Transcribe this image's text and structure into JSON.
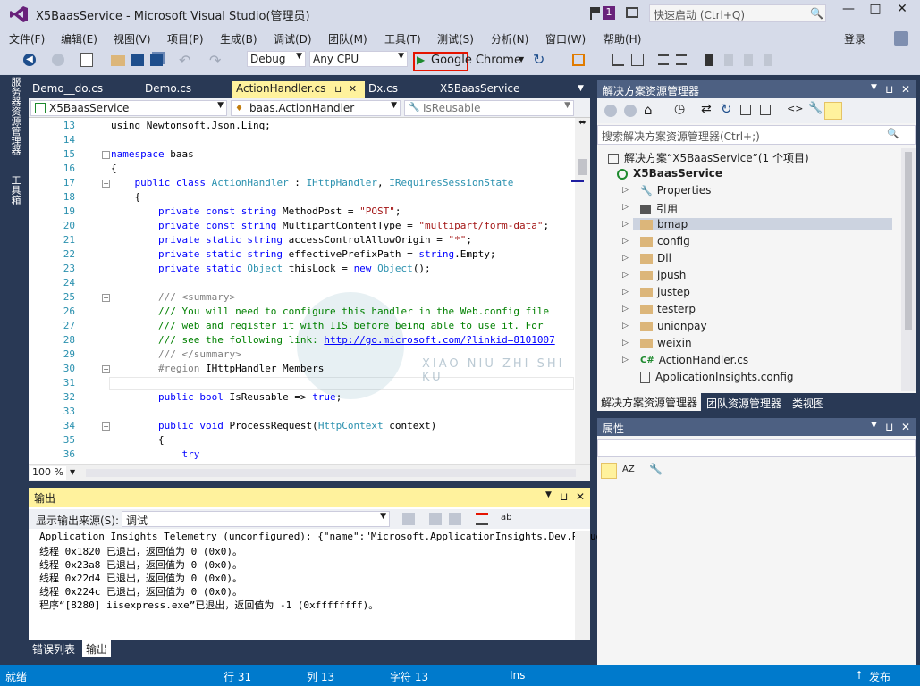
{
  "window": {
    "title": "X5BaasService - Microsoft Visual Studio(管理员)",
    "notif_count": "1",
    "quicklaunch_placeholder": "快速启动 (Ctrl+Q)",
    "login": "登录"
  },
  "menu": [
    "文件(F)",
    "编辑(E)",
    "视图(V)",
    "项目(P)",
    "生成(B)",
    "调试(D)",
    "团队(M)",
    "工具(T)",
    "测试(S)",
    "分析(N)",
    "窗口(W)",
    "帮助(H)"
  ],
  "toolbar": {
    "config": "Debug",
    "platform": "Any CPU",
    "run_target": "Google Chrome"
  },
  "sidebar": {
    "server_explorer": "服务器资源管理器",
    "toolbox": "工具箱"
  },
  "tabs": [
    "Demo__do.cs",
    "Demo.cs",
    "ActionHandler.cs",
    "Dx.cs",
    "X5BaasService"
  ],
  "nav": {
    "project": "X5BaasService",
    "class": "baas.ActionHandler",
    "member": "IsReusable"
  },
  "code": [
    {
      "n": "13",
      "t": [
        [
          "using Newtonsoft.Json.Linq;",
          ""
        ]
      ]
    },
    {
      "n": "14",
      "t": []
    },
    {
      "n": "15",
      "t": [
        [
          "namespace",
          "kw"
        ],
        [
          " baas",
          ""
        ]
      ]
    },
    {
      "n": "16",
      "t": [
        [
          "{",
          ""
        ]
      ]
    },
    {
      "n": "17",
      "t": [
        [
          "    public class ",
          "kw"
        ],
        [
          "ActionHandler",
          "ty"
        ],
        [
          " : ",
          ""
        ],
        [
          "IHttpHandler",
          "ty"
        ],
        [
          ", ",
          ""
        ],
        [
          "IRequiresSessionState",
          "ty"
        ]
      ]
    },
    {
      "n": "18",
      "t": [
        [
          "    {",
          ""
        ]
      ]
    },
    {
      "n": "19",
      "t": [
        [
          "        private const string",
          "kw"
        ],
        [
          " MethodPost = ",
          ""
        ],
        [
          "\"POST\"",
          "st"
        ],
        [
          ";",
          ""
        ]
      ]
    },
    {
      "n": "20",
      "t": [
        [
          "        private const string",
          "kw"
        ],
        [
          " MultipartContentType = ",
          ""
        ],
        [
          "\"multipart/form-data\"",
          "st"
        ],
        [
          ";",
          ""
        ]
      ]
    },
    {
      "n": "21",
      "t": [
        [
          "        private static string",
          "kw"
        ],
        [
          " accessControlAllowOrigin = ",
          ""
        ],
        [
          "\"*\"",
          "st"
        ],
        [
          ";",
          ""
        ]
      ]
    },
    {
      "n": "22",
      "t": [
        [
          "        private static string",
          "kw"
        ],
        [
          " effectivePrefixPath = ",
          ""
        ],
        [
          "string",
          "kw"
        ],
        [
          ".Empty;",
          ""
        ]
      ]
    },
    {
      "n": "23",
      "t": [
        [
          "        private static ",
          "kw"
        ],
        [
          "Object",
          "ty"
        ],
        [
          " thisLock = ",
          ""
        ],
        [
          "new ",
          "kw"
        ],
        [
          "Object",
          "ty"
        ],
        [
          "();",
          ""
        ]
      ]
    },
    {
      "n": "24",
      "t": []
    },
    {
      "n": "25",
      "t": [
        [
          "        /// ",
          "gr"
        ],
        [
          "<summary>",
          "gr"
        ]
      ]
    },
    {
      "n": "26",
      "t": [
        [
          "        /// You will need to configure this handler in the Web.config file",
          "cm"
        ]
      ]
    },
    {
      "n": "27",
      "t": [
        [
          "        /// web and register it with IIS before being able to use it. For",
          "cm"
        ]
      ]
    },
    {
      "n": "28",
      "t": [
        [
          "        /// see the following link: ",
          "cm"
        ],
        [
          "http://go.microsoft.com/?linkid=8101007",
          "lk"
        ]
      ]
    },
    {
      "n": "29",
      "t": [
        [
          "        /// </summary>",
          "gr"
        ]
      ]
    },
    {
      "n": "30",
      "t": [
        [
          "        #region",
          "gr"
        ],
        [
          " IHttpHandler Members",
          ""
        ]
      ]
    },
    {
      "n": "31",
      "t": []
    },
    {
      "n": "32",
      "t": [
        [
          "        public bool",
          "kw"
        ],
        [
          " IsReusable => ",
          ""
        ],
        [
          "true",
          "kw"
        ],
        [
          ";",
          ""
        ]
      ]
    },
    {
      "n": "33",
      "t": []
    },
    {
      "n": "34",
      "t": [
        [
          "        public void",
          "kw"
        ],
        [
          " ProcessRequest(",
          ""
        ],
        [
          "HttpContext",
          "ty"
        ],
        [
          " context)",
          ""
        ]
      ]
    },
    {
      "n": "35",
      "t": [
        [
          "        {",
          ""
        ]
      ]
    },
    {
      "n": "36",
      "t": [
        [
          "            try",
          "kw"
        ]
      ]
    }
  ],
  "zoom": "100 %",
  "output": {
    "title": "输出",
    "source_label": "显示输出来源(S):",
    "source_value": "调试",
    "lines": [
      "Application Insights Telemetry (unconfigured): {\"name\":\"Microsoft.ApplicationInsights.Dev.Request\",\"",
      "线程 0x1820 已退出，返回值为 0 (0x0)。",
      "线程 0x23a8 已退出，返回值为 0 (0x0)。",
      "线程 0x22d4 已退出，返回值为 0 (0x0)。",
      "线程 0x224c 已退出，返回值为 0 (0x0)。",
      "程序“[8280] iisexpress.exe”已退出，返回值为 -1 (0xffffffff)。"
    ]
  },
  "bottom_tabs": [
    "错误列表",
    "输出"
  ],
  "solution": {
    "title": "解决方案资源管理器",
    "search_placeholder": "搜索解决方案资源管理器(Ctrl+;)",
    "root": "解决方案“X5BaasService”(1 个项目)",
    "project": "X5BaasService",
    "items": [
      "Properties",
      "引用",
      "bmap",
      "config",
      "Dll",
      "jpush",
      "justep",
      "testerp",
      "unionpay",
      "weixin",
      "ActionHandler.cs",
      "ApplicationInsights.config"
    ],
    "tabs": [
      "解决方案资源管理器",
      "团队资源管理器",
      "类视图"
    ]
  },
  "properties": {
    "title": "属性"
  },
  "status": {
    "ready": "就绪",
    "line": "行 31",
    "col": "列 13",
    "ch": "字符 13",
    "ins": "Ins",
    "publish": "发布"
  },
  "watermark": {
    "text": "XIAO NIU ZHI SHI KU"
  }
}
